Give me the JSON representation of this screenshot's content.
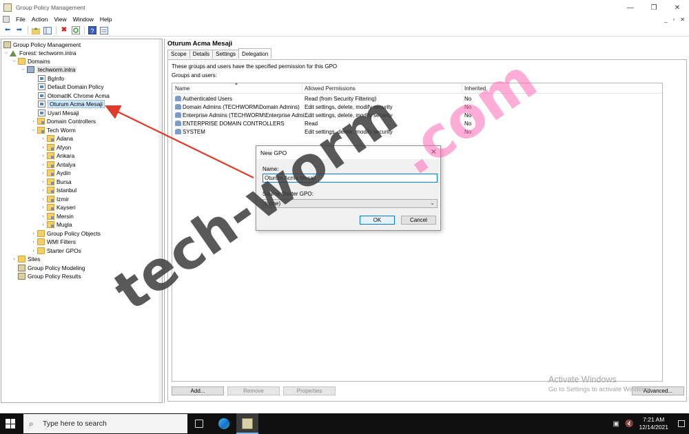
{
  "window": {
    "title": "Group Policy Management",
    "controls": [
      "—",
      "❐",
      "✕"
    ],
    "mdi_controls": [
      "_",
      "▫",
      "✕"
    ]
  },
  "menu": [
    "File",
    "Action",
    "View",
    "Window",
    "Help"
  ],
  "toolbar_icons": [
    "back-arrow-icon",
    "forward-arrow-icon",
    "folder-up-icon",
    "show-hide-tree-icon",
    "delete-icon",
    "refresh-icon",
    "help-icon",
    "properties-icon"
  ],
  "tree": {
    "root": "Group Policy Management",
    "forest": "Forest: techworm.intra",
    "domains": "Domains",
    "domain": "techworm.intra",
    "gpos": [
      "BgInfo",
      "Default Domain Policy",
      "OtomatIK Chrome Acma",
      "Oturum Acma Mesaji",
      "Uyari Mesaji"
    ],
    "domain_controllers": "Domain Controllers",
    "tech_worm": "Tech Worm",
    "ous": [
      "Adana",
      "Afyon",
      "Ankara",
      "Antalya",
      "Aydin",
      "Bursa",
      "Istanbul",
      "Izmir",
      "Kayseri",
      "Mersin",
      "Mugla"
    ],
    "gpo_objects": "Group Policy Objects",
    "wmi_filters": "WMI Filters",
    "starter_gpos": "Starter GPOs",
    "sites": "Sites",
    "modeling": "Group Policy Modeling",
    "results": "Group Policy Results"
  },
  "detail": {
    "title": "Oturum Acma Mesaji",
    "tabs": [
      "Scope",
      "Details",
      "Settings",
      "Delegation"
    ],
    "active_tab": "Delegation",
    "description": "These groups and users have the specified permission for this GPO",
    "groups_label": "Groups and users:",
    "columns": [
      "Name",
      "Allowed Permissions",
      "Inherited"
    ],
    "rows": [
      {
        "name": "Authenticated Users",
        "perm": "Read (from Security Filtering)",
        "inh": "No"
      },
      {
        "name": "Domain Admins (TECHWORM\\Domain Admins)",
        "perm": "Edit settings, delete, modify security",
        "inh": "No"
      },
      {
        "name": "Enterprise Admins (TECHWORM\\Enterprise Admi...",
        "perm": "Edit settings, delete, modify security",
        "inh": "No"
      },
      {
        "name": "ENTERPRISE DOMAIN CONTROLLERS",
        "perm": "Read",
        "inh": "No"
      },
      {
        "name": "SYSTEM",
        "perm": "Edit settings, delete, modify security",
        "inh": "No"
      }
    ],
    "buttons": {
      "add": "Add...",
      "remove": "Remove",
      "properties": "Properties",
      "advanced": "Advanced..."
    }
  },
  "dialog": {
    "title": "New GPO",
    "name_label": "Name:",
    "name_value": "Oturum Acma Mesaji",
    "source_label": "Source Starter GPO:",
    "source_value": "(none)",
    "ok": "OK",
    "cancel": "Cancel"
  },
  "watermark": {
    "dark": "tech-worm",
    "pink": ".com"
  },
  "activate": {
    "line1": "Activate Windows",
    "line2": "Go to Settings to activate Windows."
  },
  "taskbar": {
    "search_placeholder": "Type here to search",
    "time": "7:21 AM",
    "date": "12/14/2021"
  },
  "colors": {
    "arrow": "#e03a2a",
    "selection": "#cce8ff",
    "accent": "#0078d7"
  }
}
